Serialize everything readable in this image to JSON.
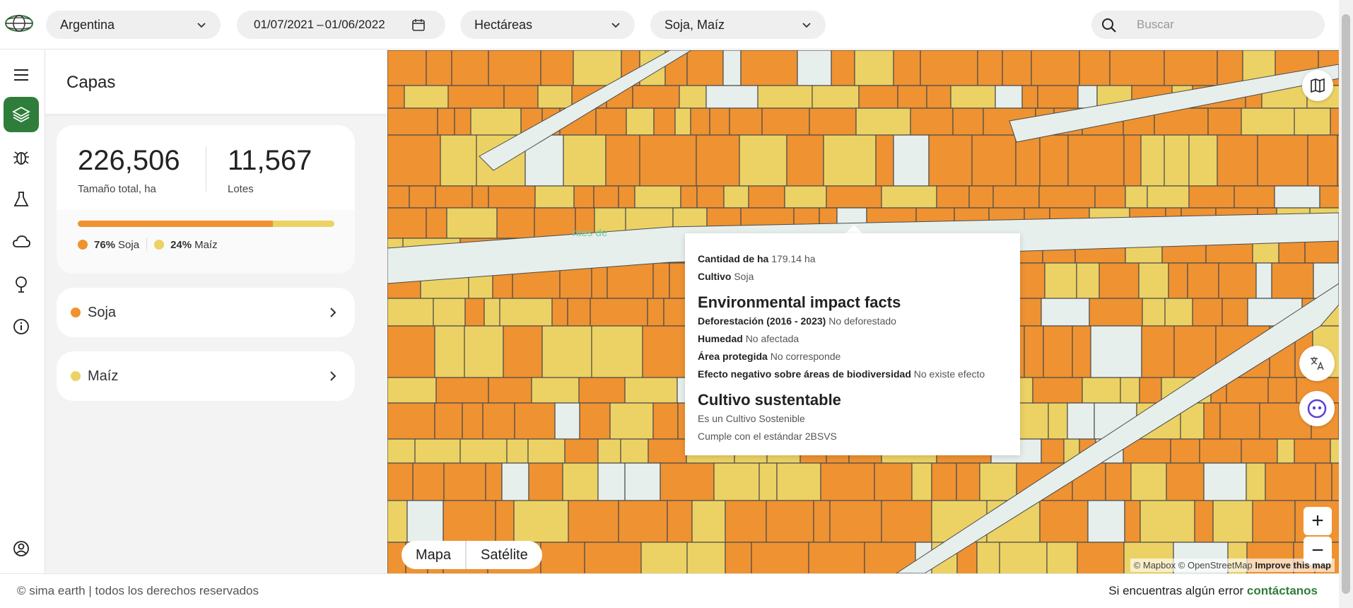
{
  "topbar": {
    "country": "Argentina",
    "date_start": "01/07/2021",
    "date_sep": "–",
    "date_end": "01/06/2022",
    "unit": "Hectáreas",
    "crops": "Soja, Maíz",
    "search_placeholder": "Buscar"
  },
  "rail": {
    "items": [
      "menu-icon",
      "layers-icon",
      "bug-icon",
      "flask-icon",
      "cloud-icon",
      "tree-icon",
      "info-icon",
      "account-icon"
    ],
    "active": "layers-icon",
    "accent": "#2f7d3a"
  },
  "panel": {
    "title": "Capas",
    "total_size": "226,506",
    "total_size_label": "Tamaño total, ha",
    "lots": "11,567",
    "lots_label": "Lotes",
    "soja_pct": "76%",
    "soja_label": "Soja",
    "maiz_pct": "24%",
    "maiz_label": "Maíz",
    "soja_share": 0.76,
    "crop_items": [
      {
        "label": "Soja",
        "color": "#f0932f"
      },
      {
        "label": "Maíz",
        "color": "#ecd264"
      }
    ]
  },
  "map": {
    "toggle_map": "Mapa",
    "toggle_satellite": "Satélite",
    "zoom_in": "+",
    "zoom_out": "−",
    "attribution_mapbox": "© Mapbox",
    "attribution_osm": "© OpenStreetMap",
    "attribution_improve": "Improve this map",
    "place_label": "ntes de",
    "colors": {
      "soja": "#ef9232",
      "maiz": "#ecd264",
      "background": "#e6efec",
      "border": "#4b4b4b"
    }
  },
  "popup": {
    "area_label": "Cantidad de ha",
    "area_value": "179.14 ha",
    "crop_label": "Cultivo",
    "crop_value": "Soja",
    "impact_title": "Environmental impact facts",
    "deforest_label": "Deforestación (2016 - 2023)",
    "deforest_value": "No deforestado",
    "humidity_label": "Humedad",
    "humidity_value": "No afectada",
    "protected_label": "Área protegida",
    "protected_value": "No corresponde",
    "biodiv_label": "Efecto negativo sobre áreas de biodiversidad",
    "biodiv_value": "No existe efecto",
    "sustainable_title": "Cultivo sustentable",
    "sustainable_line1": "Es un Cultivo Sostenible",
    "sustainable_line2": "Cumple con el estándar 2BSVS"
  },
  "footer": {
    "copyright": "© sima earth | todos los derechos reservados",
    "error_text": "Si encuentras algún error ",
    "contact_link": "contáctanos"
  }
}
